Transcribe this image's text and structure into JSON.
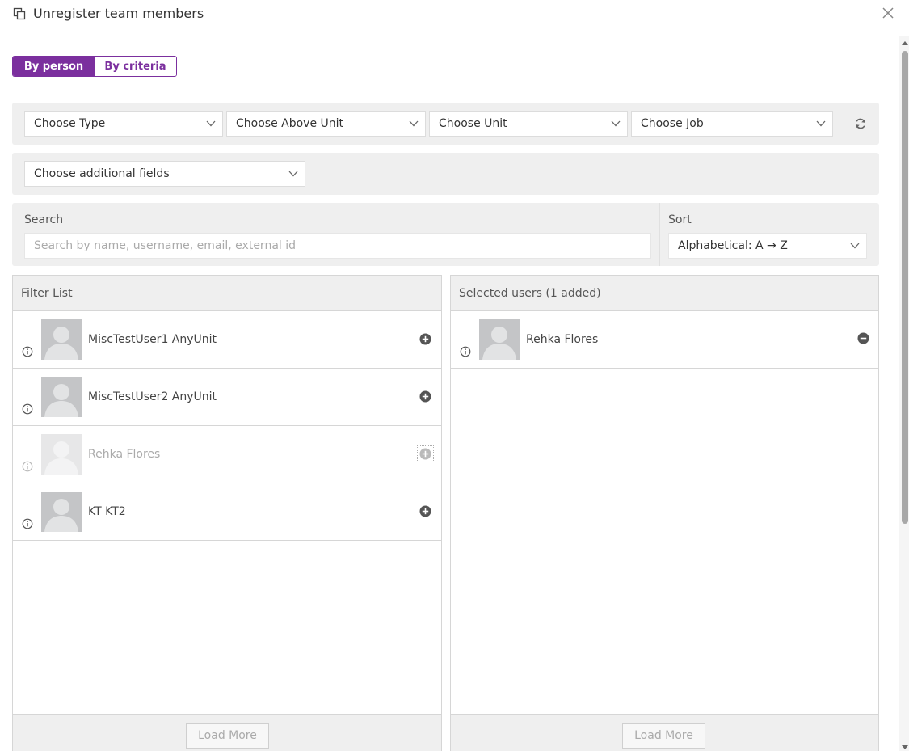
{
  "header": {
    "title": "Unregister team members"
  },
  "mode_toggle": {
    "by_person": "By person",
    "by_criteria": "By criteria",
    "selected": "By person"
  },
  "filters": {
    "type": "Choose Type",
    "above_unit": "Choose Above Unit",
    "unit": "Choose Unit",
    "job": "Choose Job",
    "additional_fields": "Choose additional fields"
  },
  "search": {
    "label": "Search",
    "placeholder": "Search by name, username, email, external id"
  },
  "sort": {
    "label": "Sort",
    "value": "Alphabetical: A → Z"
  },
  "filter_list": {
    "title": "Filter List",
    "users": [
      {
        "name": "MiscTestUser1 AnyUnit",
        "disabled": false
      },
      {
        "name": "MiscTestUser2 AnyUnit",
        "disabled": false
      },
      {
        "name": "Rehka Flores",
        "disabled": true
      },
      {
        "name": "KT KT2",
        "disabled": false
      }
    ],
    "load_more": "Load More"
  },
  "selected_list": {
    "title": "Selected users  (1 added)",
    "users": [
      {
        "name": "Rehka Flores"
      }
    ],
    "load_more": "Load More"
  },
  "colors": {
    "accent": "#7b2f9e",
    "panel_bg": "#efefef"
  },
  "icons": {
    "header": "copy-icon",
    "close": "close-icon",
    "refresh": "refresh-icon",
    "add": "plus-circle-icon",
    "remove": "minus-circle-icon",
    "info": "info-icon",
    "avatar": "user-avatar-placeholder"
  }
}
